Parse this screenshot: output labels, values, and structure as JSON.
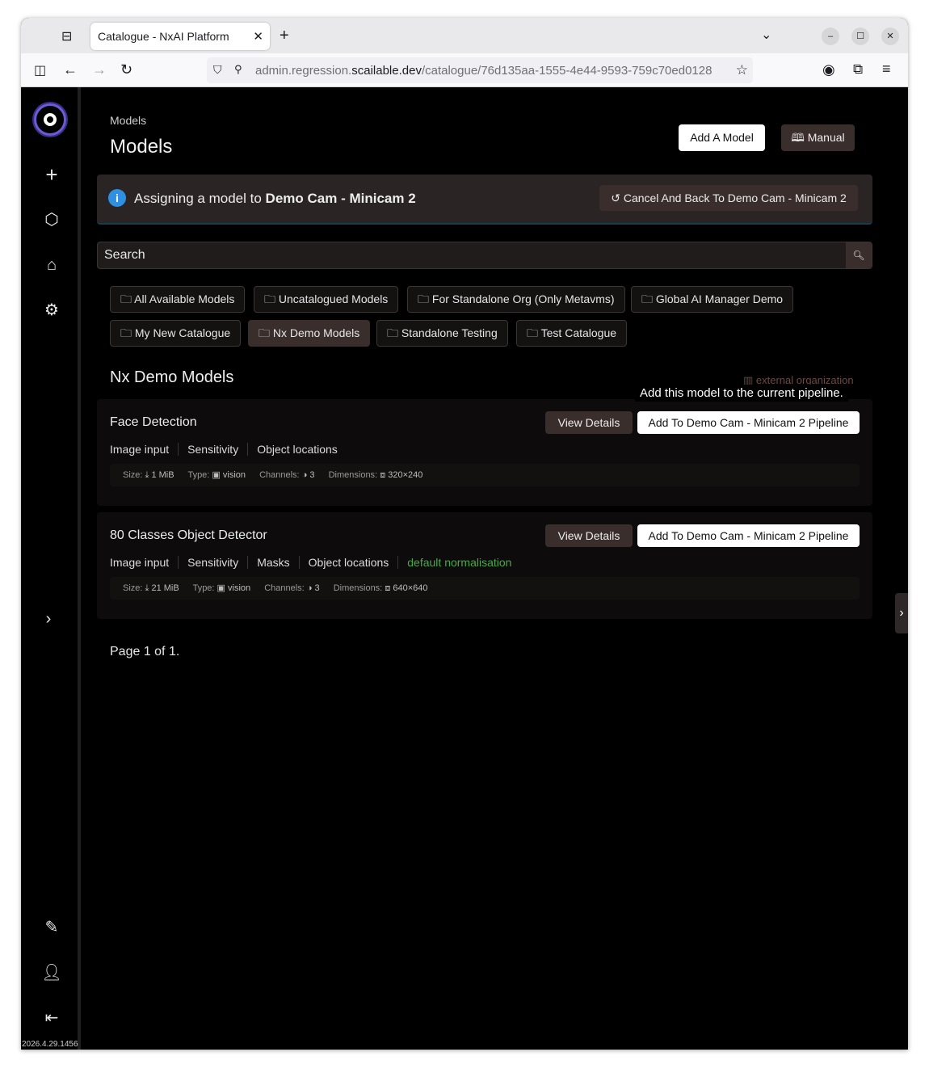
{
  "browser": {
    "tab_title": "Catalogue - NxAI Platform",
    "url_prefix": "admin.regression.",
    "url_host": "scailable.dev",
    "url_path": "/catalogue/76d135aa-1555-4e44-9593-759c70ed0128"
  },
  "sidebar": {
    "version": "2026.4.29.1456"
  },
  "header": {
    "breadcrumb": "Models",
    "title": "Models",
    "add_model_label": "Add A Model",
    "manual_label": "Manual"
  },
  "banner": {
    "prefix": "Assigning a model to ",
    "target": "Demo Cam - Minicam 2",
    "cancel_label": "Cancel And Back To Demo Cam - Minicam 2"
  },
  "search": {
    "placeholder": "Search"
  },
  "catalogues": [
    "All Available Models",
    "Uncatalogued Models",
    "For Standalone Org (Only Metavms)",
    "Global AI Manager Demo",
    "My New Catalogue",
    "Nx Demo Models",
    "Standalone Testing",
    "Test Catalogue"
  ],
  "section": {
    "title": "Nx Demo Models",
    "external_label": "external organization"
  },
  "tooltip": "Add this model to the current pipeline.",
  "models": [
    {
      "name": "Face Detection",
      "tags": [
        "Image input",
        "Sensitivity",
        "Object locations"
      ],
      "size": "1 MiB",
      "type": "vision",
      "channels": "3",
      "dimensions": "320×240"
    },
    {
      "name": "80 Classes Object Detector",
      "tags": [
        "Image input",
        "Sensitivity",
        "Masks",
        "Object locations"
      ],
      "extra_tag": "default normalisation",
      "size": "21 MiB",
      "type": "vision",
      "channels": "3",
      "dimensions": "640×640"
    }
  ],
  "labels": {
    "view_details": "View Details",
    "add_pipeline": "Add To Demo Cam - Minicam 2 Pipeline",
    "size": "Size:",
    "type": "Type:",
    "channels": "Channels:",
    "dimensions": "Dimensions:"
  },
  "pager": "Page 1 of 1.",
  "colors": {
    "accent_tag": "#49a84a",
    "info": "#2f8fe0",
    "dark_button": "#3a2e2c"
  }
}
